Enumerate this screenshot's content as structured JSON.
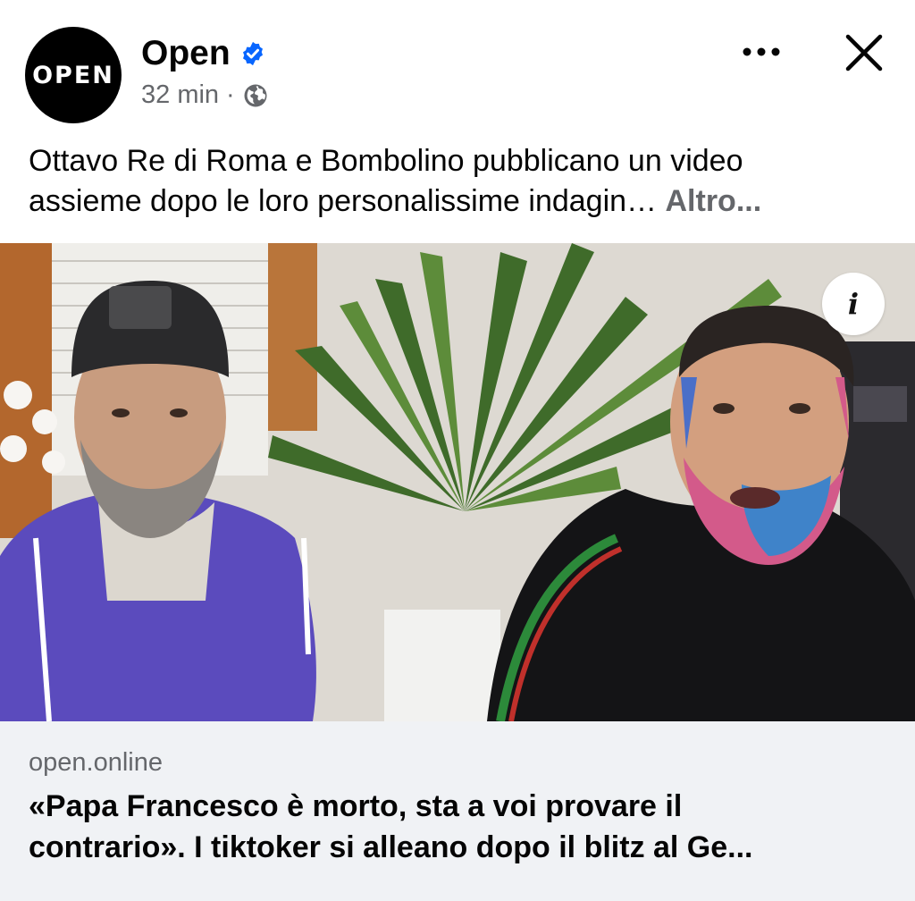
{
  "header": {
    "avatar_text": "OPEN",
    "page_name": "Open",
    "verified_icon": "verified-badge-icon",
    "time_ago": "32 min",
    "separator": "·",
    "privacy_icon": "globe-icon",
    "more_icon": "more-dots-icon",
    "close_icon": "close-icon"
  },
  "caption": {
    "line1": "Ottavo Re di Roma e Bombolino pubblicano un video",
    "line2": "assieme dopo le loro personalissime indagin…",
    "more_label": "Altro..."
  },
  "media": {
    "description_icon": "video-thumbnail",
    "info_label": "i"
  },
  "link_preview": {
    "domain": "open.online",
    "title_line1": "«Papa Francesco è morto, sta a voi provare il",
    "title_line2": "contrario». I tiktoker si alleano dopo il blitz al Ge..."
  },
  "colors": {
    "verified_blue": "#0866ff",
    "secondary_text": "#65676b",
    "link_background": "#f0f2f5"
  }
}
